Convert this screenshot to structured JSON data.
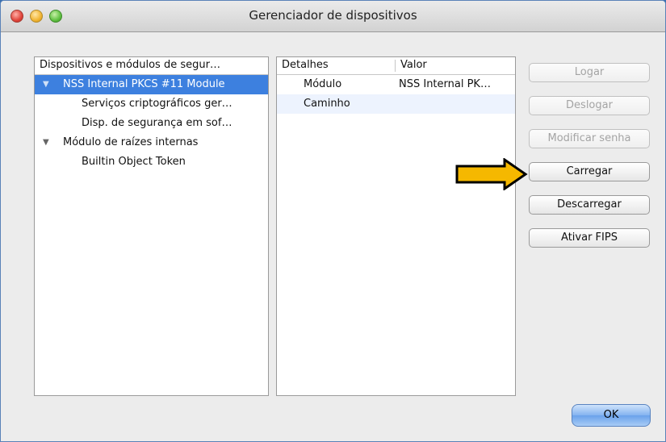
{
  "window": {
    "title": "Gerenciador de dispositivos"
  },
  "tree": {
    "header": "Dispositivos e módulos de segur…",
    "rows": [
      {
        "label": "NSS Internal PKCS #11 Module",
        "level": 0,
        "expanded": true,
        "selected": true
      },
      {
        "label": "Serviços criptográficos ger…",
        "level": 1
      },
      {
        "label": "Disp. de segurança em sof…",
        "level": 1
      },
      {
        "label": "Módulo de raízes internas",
        "level": 0,
        "expanded": true
      },
      {
        "label": "Builtin Object Token",
        "level": 1
      }
    ]
  },
  "details": {
    "columns": [
      "Detalhes",
      "Valor"
    ],
    "rows": [
      {
        "name": "Módulo",
        "value": "NSS Internal PK…"
      },
      {
        "name": "Caminho",
        "value": ""
      }
    ]
  },
  "buttons": {
    "logar": {
      "label": "Logar",
      "enabled": false
    },
    "deslogar": {
      "label": "Deslogar",
      "enabled": false
    },
    "modificar_senha": {
      "label": "Modificar senha",
      "enabled": false
    },
    "carregar": {
      "label": "Carregar",
      "enabled": true
    },
    "descarregar": {
      "label": "Descarregar",
      "enabled": true
    },
    "ativar_fips": {
      "label": "Ativar FIPS",
      "enabled": true
    },
    "ok": {
      "label": "OK",
      "enabled": true
    }
  },
  "annotation": {
    "arrow_color": "#f5b800",
    "arrow_outline": "#000000"
  },
  "colors": {
    "selection": "#3d80df",
    "alt_row": "#edf3fe",
    "background": "#3a6fb0"
  },
  "icons": {
    "close": "close-traffic-light-icon",
    "minimize": "minimize-traffic-light-icon",
    "zoom": "zoom-traffic-light-icon",
    "disclosure": "disclosure-triangle-down-icon",
    "pointer": "yellow-arrow-right-icon"
  }
}
